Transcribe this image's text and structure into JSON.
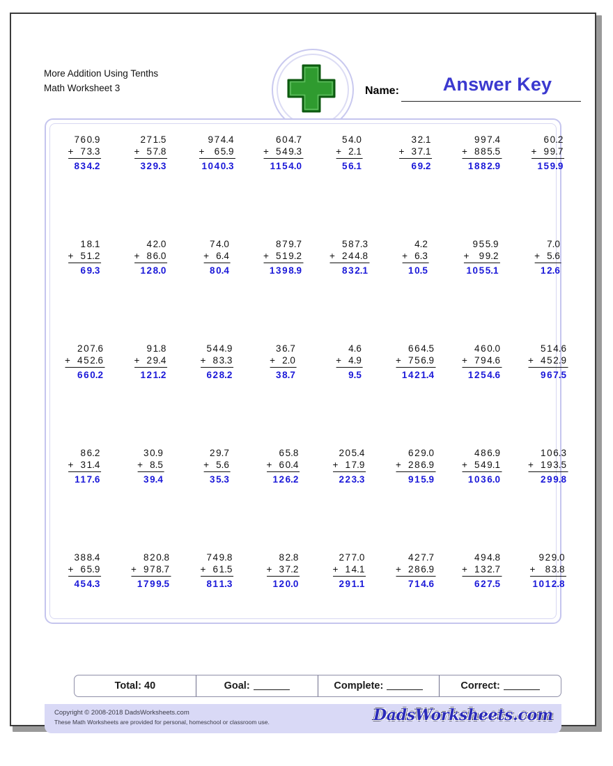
{
  "header": {
    "title_line1": "More Addition Using Tenths",
    "title_line2": "Math Worksheet 3",
    "name_label": "Name:",
    "answer_key": "Answer Key",
    "logo_icon": "green-plus-icon"
  },
  "scorebar": {
    "total_label": "Total: 40",
    "goal_label": "Goal:",
    "complete_label": "Complete:",
    "correct_label": "Correct:"
  },
  "footer": {
    "copyright": "Copyright © 2008-2018 DadsWorksheets.com",
    "usage": "These Math Worksheets are provided for personal, homeschool or classroom use.",
    "brand": "DadsWorksheets.com"
  },
  "colors": {
    "answer_blue": "#1a18d8",
    "answer_key_blue": "#3b39cf",
    "panel_lavender": "#c5c5ee",
    "footer_lavender": "#d9d9f6",
    "plus_green": "#279027"
  },
  "problems": [
    [
      {
        "a": "760.9",
        "b": "73.3",
        "op": "+",
        "sum": "834.2"
      },
      {
        "a": "271.5",
        "b": "57.8",
        "op": "+",
        "sum": "329.3"
      },
      {
        "a": "974.4",
        "b": "65.9",
        "op": "+",
        "sum": "1040.3"
      },
      {
        "a": "604.7",
        "b": "549.3",
        "op": "+",
        "sum": "1154.0"
      },
      {
        "a": "54.0",
        "b": "2.1",
        "op": "+",
        "sum": "56.1"
      },
      {
        "a": "32.1",
        "b": "37.1",
        "op": "+",
        "sum": "69.2"
      },
      {
        "a": "997.4",
        "b": "885.5",
        "op": "+",
        "sum": "1882.9"
      },
      {
        "a": "60.2",
        "b": "99.7",
        "op": "+",
        "sum": "159.9"
      }
    ],
    [
      {
        "a": "18.1",
        "b": "51.2",
        "op": "+",
        "sum": "69.3"
      },
      {
        "a": "42.0",
        "b": "86.0",
        "op": "+",
        "sum": "128.0"
      },
      {
        "a": "74.0",
        "b": "6.4",
        "op": "+",
        "sum": "80.4"
      },
      {
        "a": "879.7",
        "b": "519.2",
        "op": "+",
        "sum": "1398.9"
      },
      {
        "a": "587.3",
        "b": "244.8",
        "op": "+",
        "sum": "832.1"
      },
      {
        "a": "4.2",
        "b": "6.3",
        "op": "+",
        "sum": "10.5"
      },
      {
        "a": "955.9",
        "b": "99.2",
        "op": "+",
        "sum": "1055.1"
      },
      {
        "a": "7.0",
        "b": "5.6",
        "op": "+",
        "sum": "12.6"
      }
    ],
    [
      {
        "a": "207.6",
        "b": "452.6",
        "op": "+",
        "sum": "660.2"
      },
      {
        "a": "91.8",
        "b": "29.4",
        "op": "+",
        "sum": "121.2"
      },
      {
        "a": "544.9",
        "b": "83.3",
        "op": "+",
        "sum": "628.2"
      },
      {
        "a": "36.7",
        "b": "2.0",
        "op": "+",
        "sum": "38.7"
      },
      {
        "a": "4.6",
        "b": "4.9",
        "op": "+",
        "sum": "9.5"
      },
      {
        "a": "664.5",
        "b": "756.9",
        "op": "+",
        "sum": "1421.4"
      },
      {
        "a": "460.0",
        "b": "794.6",
        "op": "+",
        "sum": "1254.6"
      },
      {
        "a": "514.6",
        "b": "452.9",
        "op": "+",
        "sum": "967.5"
      }
    ],
    [
      {
        "a": "86.2",
        "b": "31.4",
        "op": "+",
        "sum": "117.6"
      },
      {
        "a": "30.9",
        "b": "8.5",
        "op": "+",
        "sum": "39.4"
      },
      {
        "a": "29.7",
        "b": "5.6",
        "op": "+",
        "sum": "35.3"
      },
      {
        "a": "65.8",
        "b": "60.4",
        "op": "+",
        "sum": "126.2"
      },
      {
        "a": "205.4",
        "b": "17.9",
        "op": "+",
        "sum": "223.3"
      },
      {
        "a": "629.0",
        "b": "286.9",
        "op": "+",
        "sum": "915.9"
      },
      {
        "a": "486.9",
        "b": "549.1",
        "op": "+",
        "sum": "1036.0"
      },
      {
        "a": "106.3",
        "b": "193.5",
        "op": "+",
        "sum": "299.8"
      }
    ],
    [
      {
        "a": "388.4",
        "b": "65.9",
        "op": "+",
        "sum": "454.3"
      },
      {
        "a": "820.8",
        "b": "978.7",
        "op": "+",
        "sum": "1799.5"
      },
      {
        "a": "749.8",
        "b": "61.5",
        "op": "+",
        "sum": "811.3"
      },
      {
        "a": "82.8",
        "b": "37.2",
        "op": "+",
        "sum": "120.0"
      },
      {
        "a": "277.0",
        "b": "14.1",
        "op": "+",
        "sum": "291.1"
      },
      {
        "a": "427.7",
        "b": "286.9",
        "op": "+",
        "sum": "714.6"
      },
      {
        "a": "494.8",
        "b": "132.7",
        "op": "+",
        "sum": "627.5"
      },
      {
        "a": "929.0",
        "b": "83.8",
        "op": "+",
        "sum": "1012.8"
      }
    ]
  ]
}
